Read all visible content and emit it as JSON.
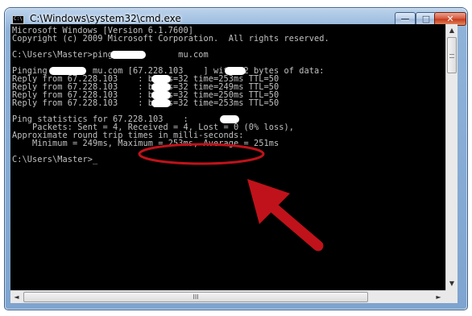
{
  "window": {
    "title": "C:\\Windows\\system32\\cmd.exe",
    "icon_label": "C:\\",
    "minimize_glyph": "—",
    "maximize_glyph": "□",
    "close_glyph": "✕"
  },
  "console": {
    "lines": [
      "Microsoft Windows [Version 6.1.7600]",
      "Copyright (c) 2009 Microsoft Corporation.  All rights reserved.",
      "",
      "C:\\Users\\Master>ping www.        mu.com",
      "",
      "Pinging         mu.com [67.228.103    ] with 32 bytes of data:",
      "Reply from 67.228.103    : bytes=32 time=253ms TTL=50",
      "Reply from 67.228.103    : bytes=32 time=249ms TTL=50",
      "Reply from 67.228.103    : bytes=32 time=250ms TTL=50",
      "Reply from 67.228.103    : bytes=32 time=253ms TTL=50",
      "",
      "Ping statistics for 67.228.103    :",
      "    Packets: Sent = 4, Received = 4, Lost = 0 (0% loss),",
      "Approximate round trip times in milli-seconds:",
      "    Minimum = 249ms, Maximum = 253ms, Average = 251ms",
      "",
      "C:\\Users\\Master>_"
    ],
    "text_color": "#c0c0c0",
    "background": "#000000"
  },
  "scrollbars": {
    "up_arrow": "▲",
    "down_arrow": "▼",
    "left_arrow": "◄",
    "right_arrow": "►",
    "h_thumb_grip": "III"
  },
  "annotation": {
    "color": "#c0121a",
    "kind": "red ellipse and arrow highlighting IP address"
  }
}
